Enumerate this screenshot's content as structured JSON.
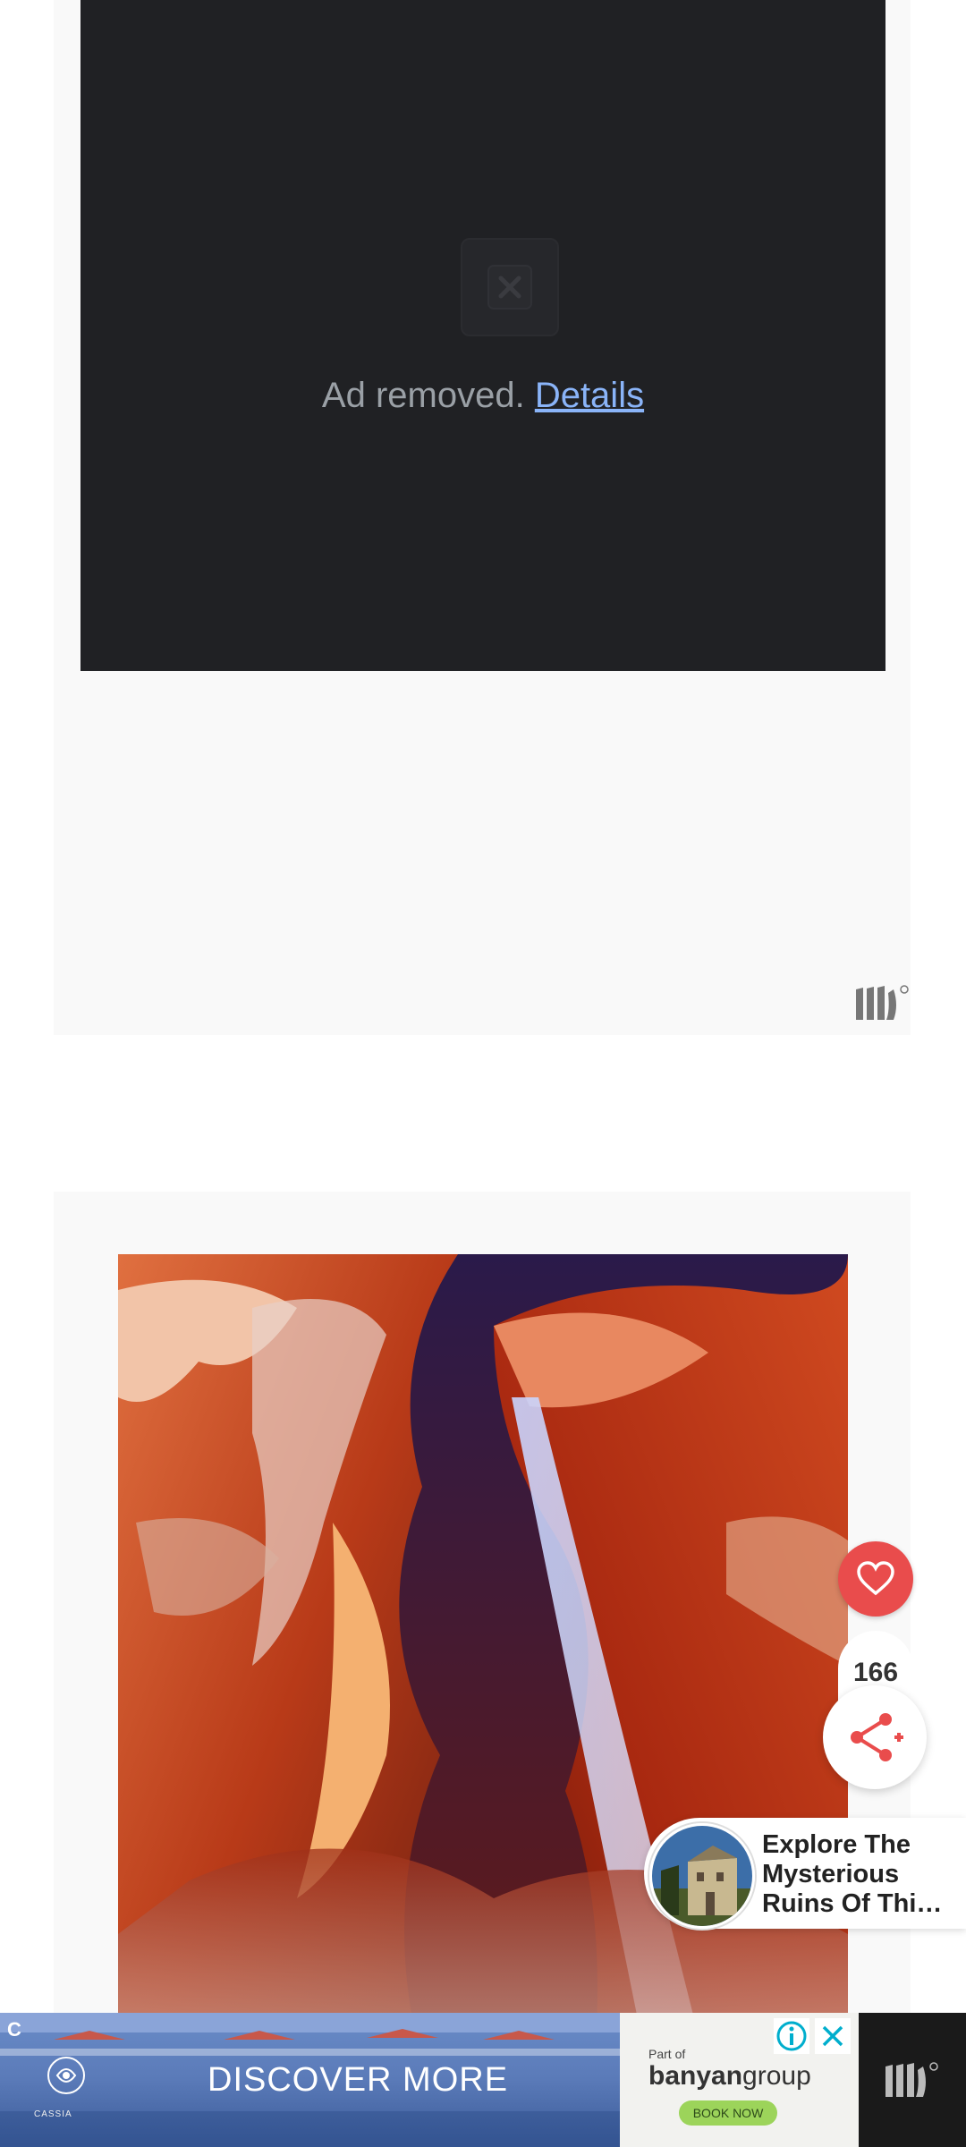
{
  "ad_block": {
    "message": "Ad removed.",
    "details_link": "Details"
  },
  "share_widget": {
    "like_count": "166"
  },
  "explore_popup": {
    "line1": "Explore The",
    "line2": "Mysterious",
    "line3": "Ruins Of Thi…"
  },
  "bottom_ad": {
    "corner_letter": "C",
    "cta": "DISCOVER MORE",
    "brand": "CASSIA",
    "banyan_part_of": "Part of",
    "banyan_bold": "banyan",
    "banyan_light": "group",
    "book_now": "BOOK NOW"
  },
  "icons": [
    "close-x-icon",
    "mediavine-logo-icon",
    "heart-icon",
    "share-icon",
    "info-icon",
    "close-icon"
  ],
  "colors": {
    "ad_dark": "#202124",
    "link": "#8ab4f8",
    "heart": "#e94c4c",
    "card_bg": "#f9f9f9"
  }
}
